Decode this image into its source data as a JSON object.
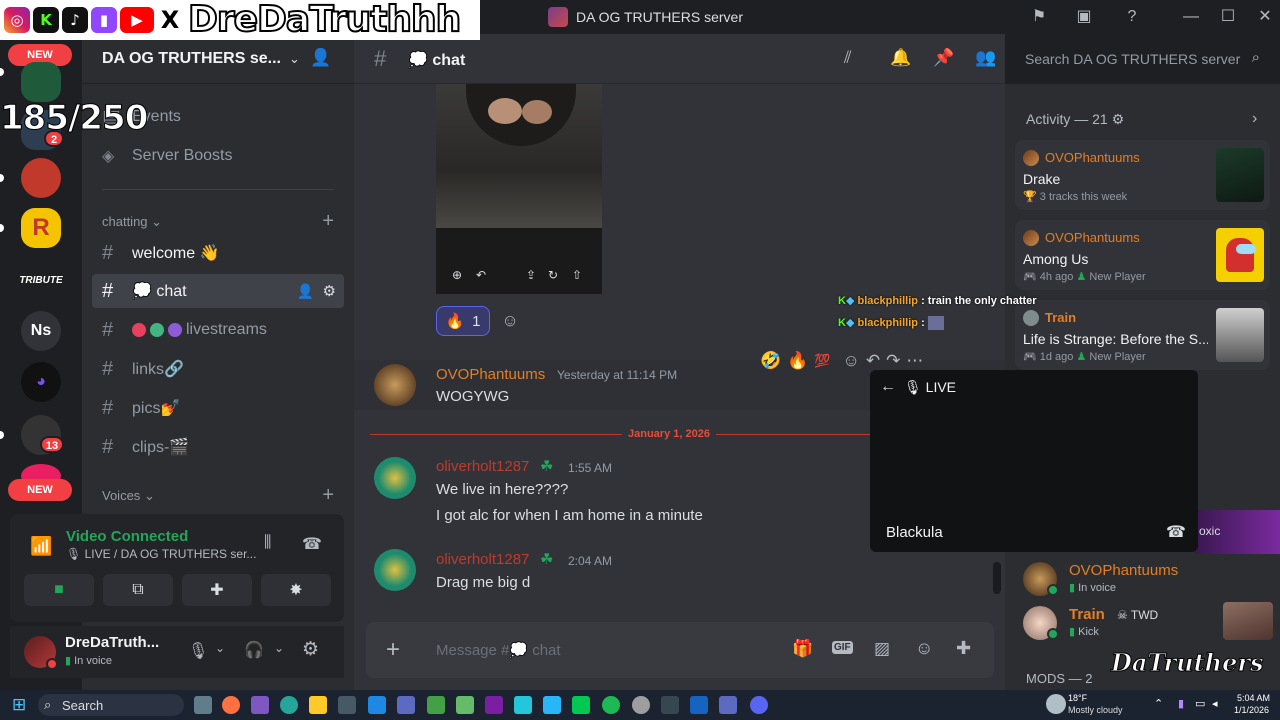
{
  "overlay": {
    "social_handle": "DreDaTruthhh",
    "member_count": "185/250",
    "new_badge": "NEW",
    "socials": [
      "instagram-icon",
      "kick-icon",
      "tiktok-icon",
      "twitch-icon",
      "youtube-icon",
      "x-icon"
    ]
  },
  "window": {
    "title": "DA OG TRUTHERS server"
  },
  "rail": {
    "badge_2": "2",
    "badge_13": "13",
    "ns_label": "Ns",
    "tribute_label": "TRIBUTE",
    "new_badge_bottom": "NEW"
  },
  "sidebar": {
    "server_name": "DA OG TRUTHERS se...",
    "events_label": "Events",
    "boosts_label": "Server Boosts",
    "category_chatting": "chatting",
    "channels": [
      {
        "label": "welcome 👋"
      },
      {
        "label": "💭 chat"
      },
      {
        "label": "livestreams"
      },
      {
        "label": "links🔗"
      },
      {
        "label": "pics💅"
      },
      {
        "label": "clips-🎬"
      }
    ],
    "category_voices": "Voices"
  },
  "voice": {
    "status": "Video Connected",
    "location": "LIVE / DA OG TRUTHERS ser..."
  },
  "user": {
    "name": "DreDaTruth...",
    "status": "In voice"
  },
  "header": {
    "channel_name": "💭 chat",
    "search_placeholder": "Search DA OG TRUTHERS server"
  },
  "messages": {
    "reaction_fire_count": "1",
    "m1_author": "OVOPhantuums",
    "m1_time": "Yesterday at 11:14 PM",
    "m1_text": "WOGYWG",
    "divider_date": "January 1, 2026",
    "m2_author": "oliverholt1287",
    "m2_time": "1:55 AM",
    "m2_text1": "We live in here????",
    "m2_text2": "I got alc for when I am home in a minute",
    "m3_author": "oliverholt1287",
    "m3_time": "2:04 AM",
    "m3_text": "Drag me big d"
  },
  "composer": {
    "placeholder": "Message #💭 chat"
  },
  "overlay_chat": [
    {
      "user": "blackphillip",
      "text": ": train the only chatter"
    },
    {
      "user": "blackphillip",
      "text": ":"
    }
  ],
  "activity": {
    "header": "Activity — 21",
    "cards": [
      {
        "user": "OVOPhantuums",
        "title": "Drake",
        "sub": "3 tracks this week"
      },
      {
        "user": "OVOPhantuums",
        "title": "Among Us",
        "sub_time": "4h ago",
        "sub_tag": "New Player"
      },
      {
        "user": "Train",
        "title": "Life is Strange: Before the S...",
        "sub_time": "1d ago",
        "sub_tag": "New Player"
      }
    ],
    "members": [
      {
        "name": "OVOPhantuums",
        "status": "In voice"
      },
      {
        "name": "Train",
        "tag": "TWD",
        "status": "Kick"
      }
    ],
    "toxic_label": "oxic",
    "mods_label": "MODS — 2",
    "watermark": "DaTruthers"
  },
  "live": {
    "title": "LIVE",
    "streamer": "Blackula"
  },
  "taskbar": {
    "search_label": "Search",
    "weather_temp": "18°F",
    "weather_desc": "Mostly cloudy",
    "time": "5:04 AM",
    "date": "1/1/2026"
  },
  "colors": {
    "accent": "#5865f2",
    "green": "#23a55a",
    "red": "#f23f43",
    "orange_user": "#e67e22",
    "red_user": "#c0392b"
  }
}
